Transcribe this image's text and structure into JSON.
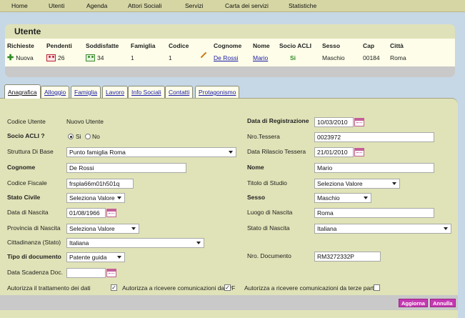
{
  "nav": [
    "Home",
    "Utenti",
    "Agenda",
    "Attori Sociali",
    "Servizi",
    "Carta dei servizi",
    "Statistiche"
  ],
  "panel": {
    "title": "Utente",
    "headers": [
      "Richieste",
      "Pendenti",
      "Soddisfatte",
      "Famiglia",
      "Codice",
      "Cognome",
      "Nome",
      "Socio ACLI",
      "Sesso",
      "Cap",
      "Città"
    ],
    "row": {
      "richieste": "Nuova",
      "pendenti": "26",
      "soddisfatte": "34",
      "famiglia": "1",
      "codice": "1",
      "cognome": "De Rossi",
      "nome": "Mario",
      "socio_acli": "Si",
      "sesso": "Maschio",
      "cap": "00184",
      "citta": "Roma"
    }
  },
  "tabs": [
    "Anagrafica",
    "Alloggio",
    "Famiglia",
    "Lavoro",
    "Info Sociali",
    "Contatti",
    "Protagonismo"
  ],
  "form": {
    "codice_utente_label": "Codice Utente",
    "codice_utente_value": "Nuovo Utente",
    "socio_label": "Socio ACLI ?",
    "socio_si": "Si",
    "socio_no": "No",
    "struttura_label": "Struttura Di Base",
    "struttura_value": "Punto famiglia Roma",
    "cognome_label": "Cognome",
    "cognome_value": "De Rossi",
    "cf_label": "Codice Fiscale",
    "cf_value": "frspla66m01h501q",
    "stato_civile_label": "Stato Civile",
    "stato_civile_value": "Seleziona Valore",
    "data_nascita_label": "Data di Nascita",
    "data_nascita_value": "01/08/1966",
    "provincia_label": "Provincia di Nascita",
    "provincia_value": "Seleziona Valore",
    "cittadinanza_label": "Cittadinanza (Stato)",
    "cittadinanza_value": "Italiana",
    "tipo_doc_label": "Tipo di documento",
    "tipo_doc_value": "Patente guida",
    "scadenza_label": "Data Scadenza Doc.",
    "scadenza_value": "",
    "data_reg_label": "Data di Registrazione",
    "data_reg_value": "10/03/2010",
    "tessera_label": "Nro.Tessera",
    "tessera_value": "0023972",
    "rilascio_label": "Data Rilascio Tessera",
    "rilascio_value": "21/01/2010",
    "nome_label": "Nome",
    "nome_value": "Mario",
    "titolo_label": "Titolo di Studio",
    "titolo_value": "Seleziona Valore",
    "sesso_label": "Sesso",
    "sesso_value": "Maschio",
    "luogo_label": "Luogo di Nascita",
    "luogo_value": "Roma",
    "stato_nascita_label": "Stato di Nascita",
    "stato_nascita_value": "Italiana",
    "nro_doc_label": "Nro. Documento",
    "nro_doc_value": "RM3272332P",
    "consent1": "Autorizza il trattamento dei dati",
    "consent2": "Autorizza a ricevere comunicazioni dai PF",
    "consent3": "Autorizza a ricevere comunicazioni da terze parti"
  },
  "buttons": {
    "update": "Aggiorna",
    "cancel": "Annulla"
  }
}
